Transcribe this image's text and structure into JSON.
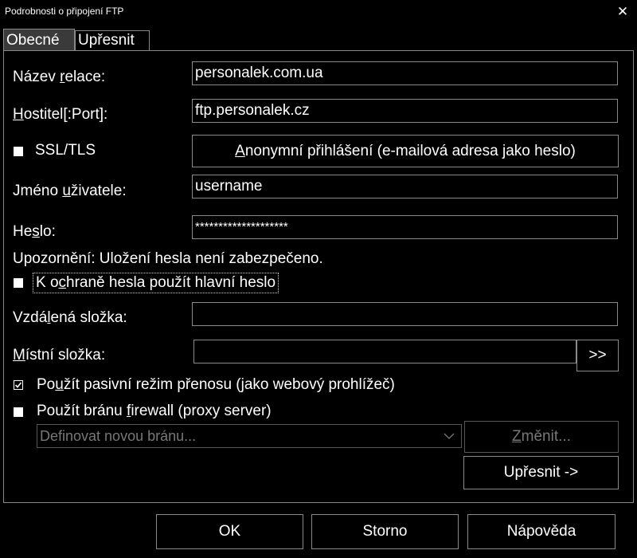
{
  "window": {
    "title": "Podrobnosti o připojení FTP",
    "close_glyph": "✕"
  },
  "tabs": [
    {
      "label": "Obecné",
      "active": true
    },
    {
      "label": "Upřesnit",
      "active": false
    }
  ],
  "form": {
    "session_name": {
      "label_pre": "Název ",
      "label_u": "r",
      "label_post": "elace:",
      "value": "personalek.com.ua"
    },
    "host": {
      "label_pre": "",
      "label_u": "H",
      "label_post": "ostitel[:Port]:",
      "value": "ftp.personalek.cz"
    },
    "ssl": {
      "label": "SSL/TLS",
      "checked": false
    },
    "anonymous_button": {
      "label_pre": "",
      "label_u": "A",
      "label_post": "nonymní přihlášení (e-mailová adresa jako heslo)"
    },
    "username": {
      "label_pre": "Jméno ",
      "label_u": "u",
      "label_post": "živatele:",
      "value": "username"
    },
    "password": {
      "label_pre": "He",
      "label_u": "s",
      "label_post": "lo:",
      "value": "********************"
    },
    "warning": "Upozornění: Uložení hesla není zabezpečeno.",
    "master_password": {
      "label_pre": "K o",
      "label_u": "c",
      "label_post": "hraně hesla použít hlavní heslo",
      "checked": false
    },
    "remote_folder": {
      "label_pre": "Vzdá",
      "label_u": "l",
      "label_post": "ená složka:",
      "value": ""
    },
    "local_folder": {
      "label_pre": "",
      "label_u": "M",
      "label_post": "ístní složka:",
      "value": "",
      "browse_label": ">>"
    },
    "passive": {
      "label_pre": "Po",
      "label_u": "u",
      "label_post": "žít pasivní režim přenosu (jako webový prohlížeč)",
      "checked": true
    },
    "firewall": {
      "label_pre": "Použít bránu ",
      "label_u": "f",
      "label_post": "irewall (proxy server)",
      "checked": false
    },
    "proxy_combo": {
      "value": "Definovat novou bránu...",
      "enabled": false
    },
    "change_button": {
      "label_pre": "",
      "label_u": "Z",
      "label_post": "měnit...",
      "enabled": false
    },
    "advanced_button": {
      "label": "Upřesnit ->"
    }
  },
  "footer": {
    "ok": "OK",
    "cancel": "Storno",
    "help": "Nápověda"
  },
  "colors": {
    "background": "#000000",
    "text": "#ffffff",
    "border": "#8a8a8a",
    "disabled": "#777777"
  }
}
